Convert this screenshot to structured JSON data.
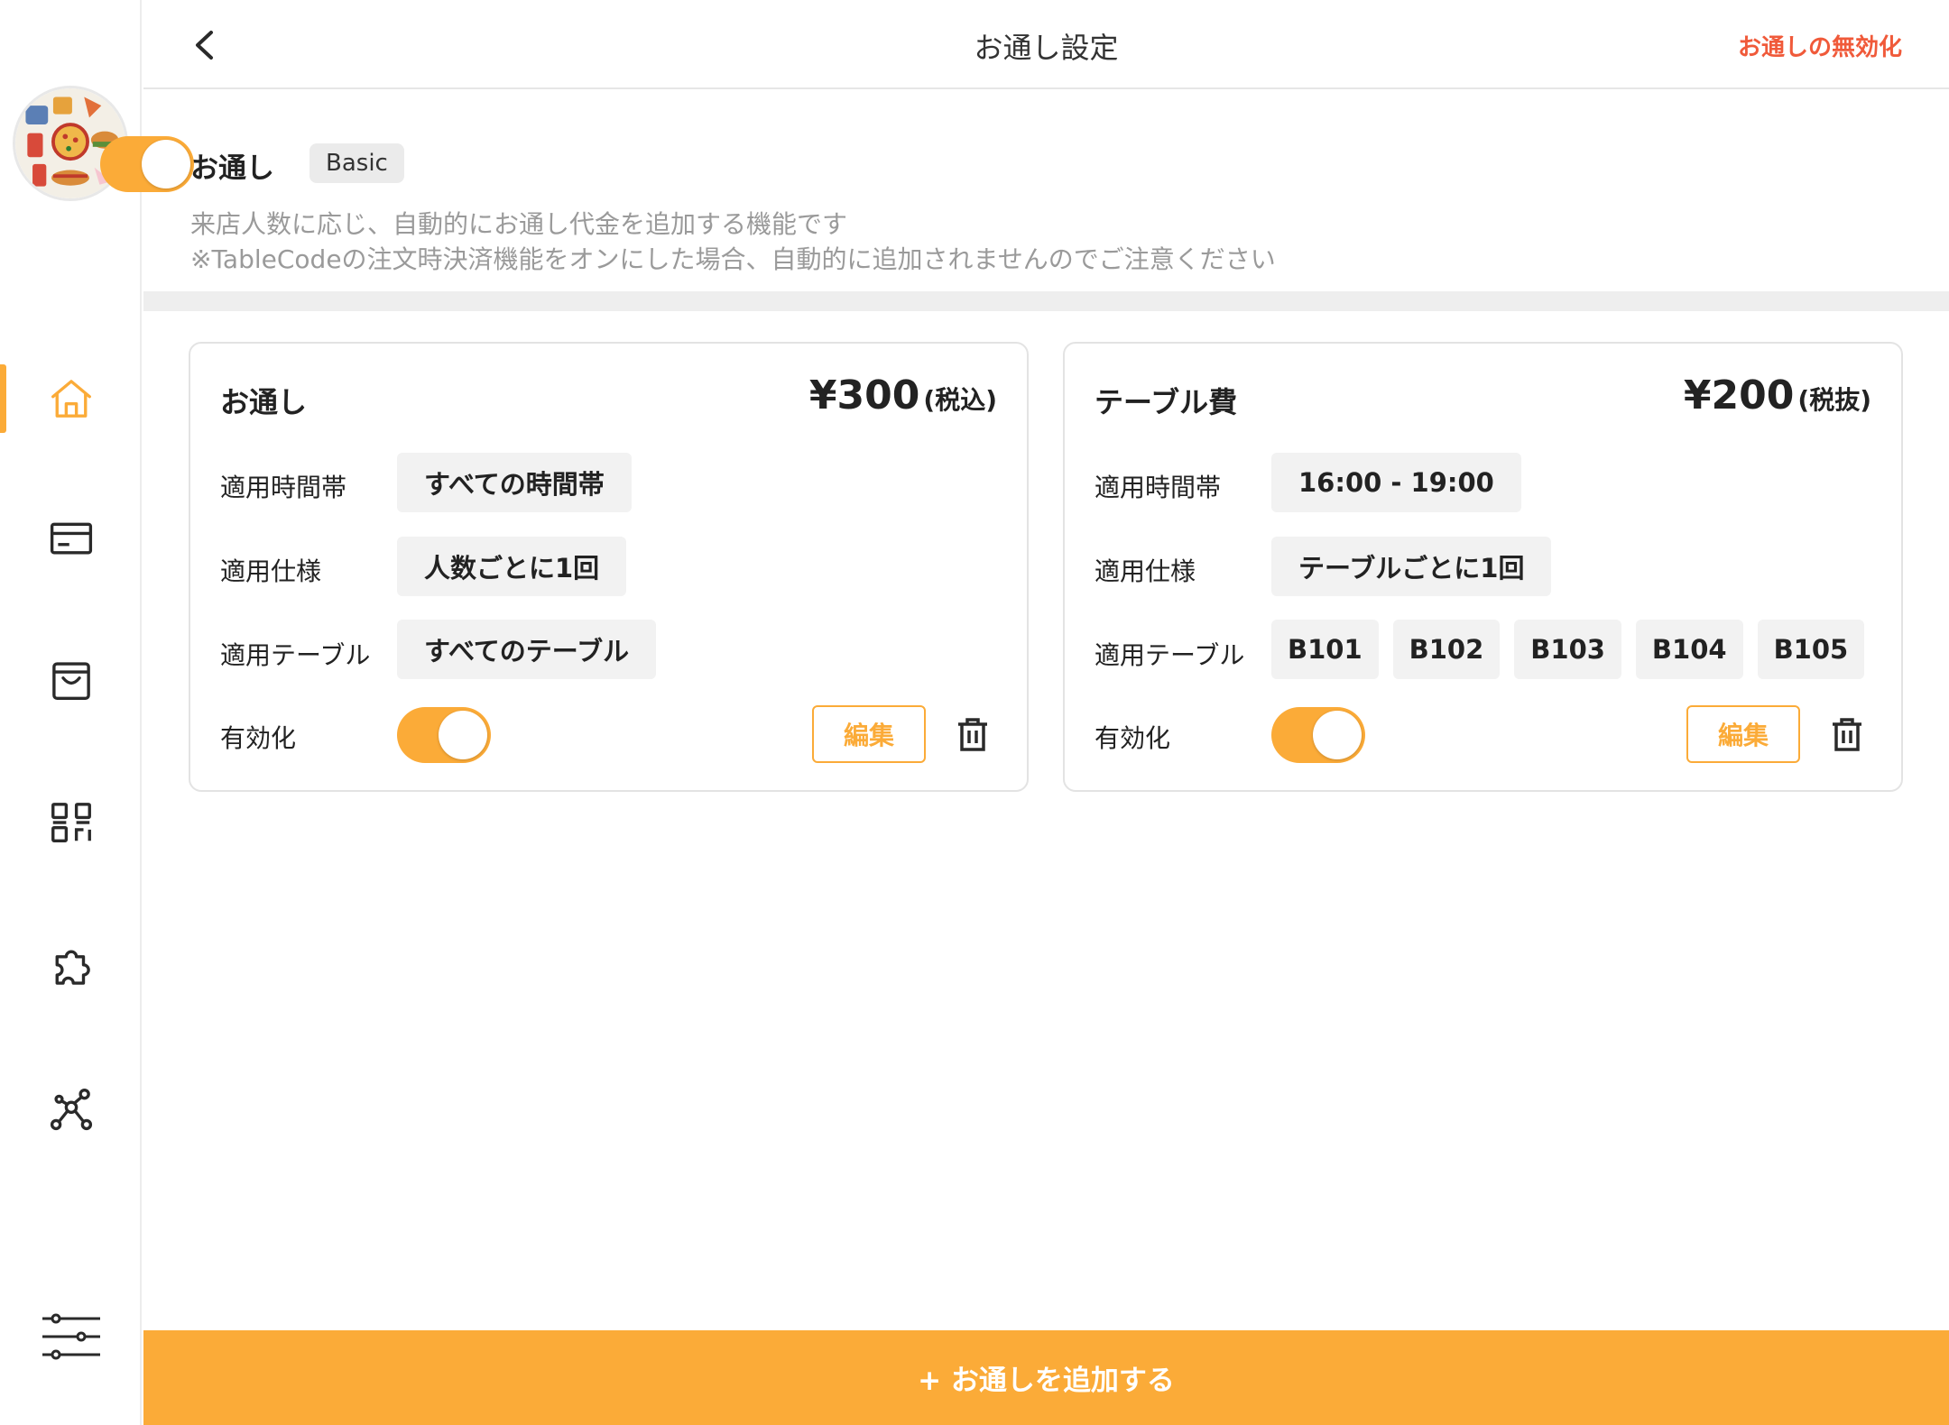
{
  "header": {
    "title": "お通し設定",
    "disable_link": "お通しの無効化"
  },
  "feature": {
    "title": "お通し",
    "badge": "Basic",
    "description_line1": "来店人数に応じ、自動的にお通し代金を追加する機能です",
    "description_line2": "※TableCodeの注文時決済機能をオンにした場合、自動的に追加されませんのでご注意ください",
    "enabled": true
  },
  "labels": {
    "time": "適用時間帯",
    "spec": "適用仕様",
    "tables": "適用テーブル",
    "enable": "有効化",
    "edit": "編集"
  },
  "cards": [
    {
      "name": "お通し",
      "price": "¥300",
      "tax": "(税込)",
      "time": "すべての時間帯",
      "spec": "人数ごとに1回",
      "tables": [
        "すべてのテーブル"
      ],
      "enabled": true
    },
    {
      "name": "テーブル費",
      "price": "¥200",
      "tax": "(税抜)",
      "time": "16:00 - 19:00",
      "spec": "テーブルごとに1回",
      "tables": [
        "B101",
        "B102",
        "B103",
        "B104",
        "B105"
      ],
      "enabled": true
    }
  ],
  "add_button": "+ お通しを追加する",
  "colors": {
    "accent": "#fbab38",
    "danger": "#f05a3a"
  },
  "sidebar": {
    "items": [
      {
        "icon": "home-icon",
        "active": true
      },
      {
        "icon": "card-icon",
        "active": false
      },
      {
        "icon": "shopping-bag-icon",
        "active": false
      },
      {
        "icon": "qr-code-icon",
        "active": false
      },
      {
        "icon": "puzzle-icon",
        "active": false
      },
      {
        "icon": "network-icon",
        "active": false
      },
      {
        "icon": "settings-sliders-icon",
        "active": false
      }
    ]
  }
}
